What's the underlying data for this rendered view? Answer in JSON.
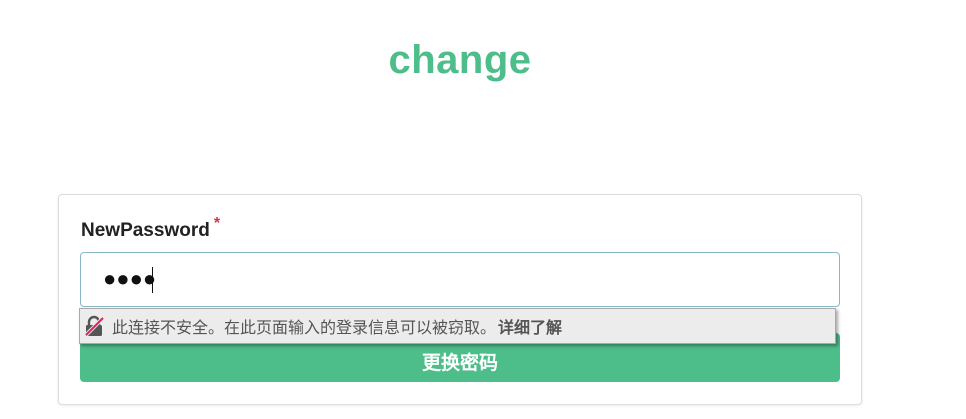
{
  "page": {
    "title": "change"
  },
  "form": {
    "field_label": "NewPassword",
    "required_mark": "*",
    "password_masked": "●●●●",
    "submit_label": "更换密码"
  },
  "security_warning": {
    "icon": "insecure-lock-icon",
    "message": "此连接不安全。在此页面输入的登录信息可以被窃取。",
    "link_label": "详细了解"
  },
  "colors": {
    "accent": "#4dbd8a",
    "required": "#d9324a",
    "input_border": "#88b7c8",
    "warning_strike": "#e0245e"
  }
}
